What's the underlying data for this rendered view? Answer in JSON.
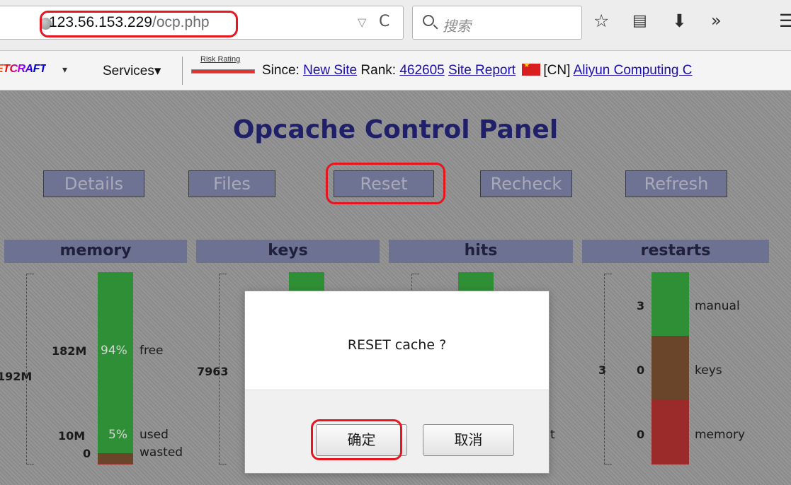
{
  "browser": {
    "url_host": "123.56.153.229",
    "url_path": "/ocp.php",
    "search_placeholder": "搜索",
    "dropmarker": "▽",
    "reload": "C"
  },
  "netcraft": {
    "logo": "ETCRAFT",
    "logo_arrow": "▾",
    "services": "Services▾",
    "risk_label": "Risk Rating",
    "since_label": "Since:",
    "since_value": "New Site",
    "rank_label": "Rank:",
    "rank_value": "462605",
    "site_report": "Site Report",
    "country": "[CN]",
    "host": "Aliyun Computing C"
  },
  "page": {
    "title": "Opcache Control Panel",
    "nav": [
      "Details",
      "Files",
      "Reset",
      "Recheck",
      "Refresh"
    ],
    "columns": [
      "memory",
      "keys",
      "hits",
      "restarts"
    ]
  },
  "memory": {
    "total": "192M",
    "free_value": "182M",
    "free_pct": "94%",
    "free_label": "free",
    "used_value": "10M",
    "used_pct": "5%",
    "used_label": "used",
    "wasted_value": "0",
    "wasted_label": "wasted",
    "free_fraction": 0.94,
    "used_fraction": 0.05,
    "wasted_fraction": 0.01
  },
  "keys": {
    "total": "7963"
  },
  "hits": {
    "partial_label": "t"
  },
  "restarts": {
    "total": "3",
    "manual_value": "3",
    "manual_label": "manual",
    "keys_value": "0",
    "keys_label": "keys",
    "memory_value": "0",
    "memory_label": "memory"
  },
  "dialog": {
    "message": "RESET cache ?",
    "ok_label": "确定",
    "cancel_label": "取消"
  },
  "colors": {
    "accent_highlight": "#e8141e",
    "title": "#20206a",
    "bar_green": "#2f8f36",
    "bar_brown": "#6a452a",
    "bar_red": "#9b2a2a"
  }
}
